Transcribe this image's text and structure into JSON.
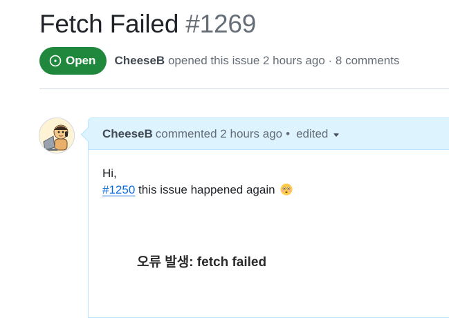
{
  "issue": {
    "title": "Fetch Failed",
    "number": "#1269",
    "state": "Open",
    "author": "CheeseB",
    "meta_text": "opened this issue 2 hours ago · 8 comments"
  },
  "comment": {
    "author": "CheeseB",
    "action_text": "commented 2 hours ago",
    "separator": "•",
    "edited_label": "edited",
    "body": {
      "greeting": "Hi,",
      "linked_issue": "#1250",
      "message": "this issue happened again",
      "error_message": "오류 발생: fetch failed"
    }
  },
  "icons": {
    "state": "issue-opened-icon",
    "edited_menu": "triangle-down-icon",
    "emoji": "flushed-face-emoji"
  },
  "colors": {
    "open_badge": "#1f883d",
    "comment_header_bg": "#ddf4ff",
    "comment_border": "#b6e3ff",
    "link": "#0969da",
    "muted_text": "#656d76"
  }
}
